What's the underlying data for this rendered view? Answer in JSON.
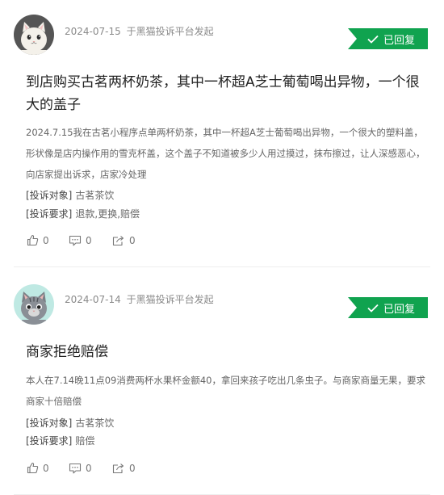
{
  "complaints": [
    {
      "date": "2024-07-15",
      "source": "于黑猫投诉平台发起",
      "status": "已回复",
      "title": "到店购买古茗两杯奶茶，其中一杯超A芝士葡萄喝出异物，一个很大的盖子",
      "description": "2024.7.15我在古茗小程序点单两杯奶茶，其中一杯超A芝士葡萄喝出异物，一个很大的塑料盖，形状像是店内操作用的雪克杯盖，这个盖子不知道被多少人用过摸过，抹布擦过，让人深感恶心，向店家提出诉求，店家冷处理",
      "target_label": "[投诉对象]",
      "target_value": "古茗茶饮",
      "demand_label": "[投诉要求]",
      "demand_value": "退款,更换,赔偿",
      "likes": "0",
      "comments": "0",
      "shares": "0",
      "avatar_icon": "white-cat-avatar"
    },
    {
      "date": "2024-07-14",
      "source": "于黑猫投诉平台发起",
      "status": "已回复",
      "title": "商家拒绝赔偿",
      "description": "本人在7.14晚11点09消费两杯水果杯金额40，拿回来孩子吃出几条虫子。与商家商量无果，要求商家十倍赔偿",
      "target_label": "[投诉对象]",
      "target_value": "古茗茶饮",
      "demand_label": "[投诉要求]",
      "demand_value": "赔偿",
      "likes": "0",
      "comments": "0",
      "shares": "0",
      "avatar_icon": "gray-cat-avatar"
    }
  ],
  "colors": {
    "badge": "#10a34f",
    "meta_text": "#8a8a8a",
    "title_text": "#222222",
    "divider": "#eeeeee"
  }
}
